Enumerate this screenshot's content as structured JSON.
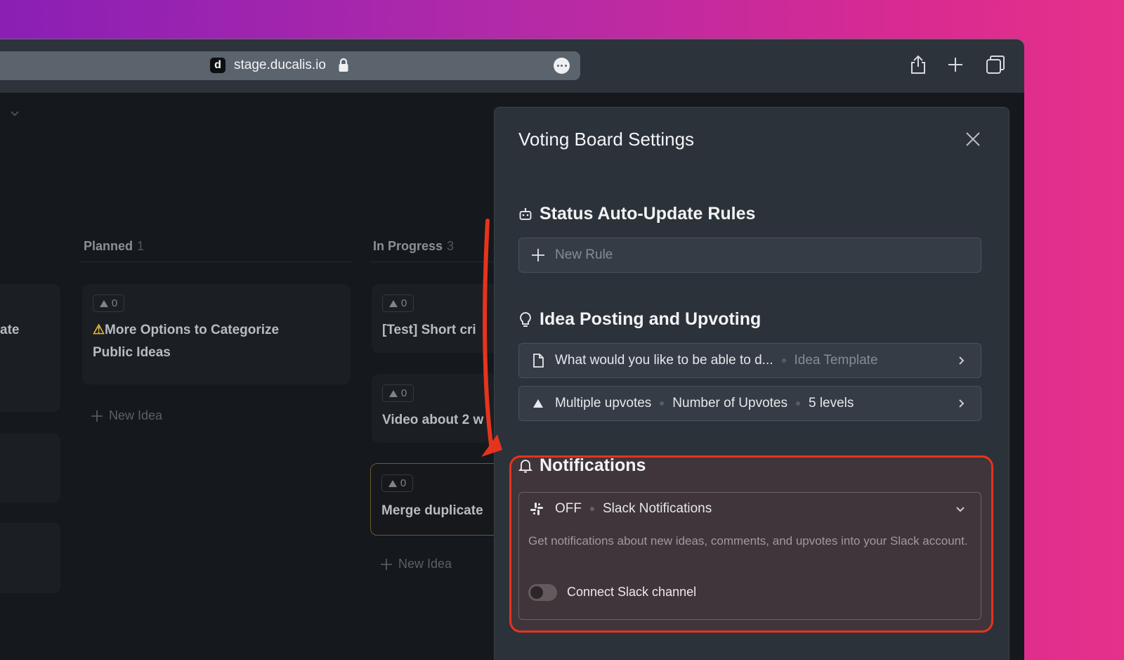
{
  "browser": {
    "favicon_letter": "d",
    "url": "stage.ducalis.io"
  },
  "board": {
    "columns": [
      {
        "title": "Planned",
        "count": "1"
      },
      {
        "title": "In Progress",
        "count": "3"
      }
    ],
    "left_fragment": "ate",
    "planned_cards": [
      {
        "votes": "0",
        "title_line1": "More Options to Categorize",
        "title_line2": "Public Ideas"
      }
    ],
    "in_progress_cards": [
      {
        "votes": "0",
        "title": "[Test] Short cri"
      },
      {
        "votes": "0",
        "title": "Video about 2 w"
      },
      {
        "votes": "0",
        "title": "Merge duplicate"
      }
    ],
    "new_idea_label": "New Idea"
  },
  "settings": {
    "title": "Voting Board Settings",
    "status_section": {
      "title": "Status Auto-Update Rules",
      "new_rule_placeholder": "New Rule"
    },
    "idea_section": {
      "title": "Idea Posting and Upvoting",
      "template_row": {
        "text": "What would you like to be able to d...",
        "tag": "Idea Template"
      },
      "upvote_row": {
        "mode": "Multiple upvotes",
        "label": "Number of Upvotes",
        "levels": "5 levels"
      }
    },
    "notifications": {
      "title": "Notifications",
      "status": "OFF",
      "name": "Slack Notifications",
      "description": "Get notifications about new ideas, comments, and upvotes into your Slack account.",
      "toggle_label": "Connect Slack channel",
      "toggle_on": false
    }
  },
  "colors": {
    "highlight": "#e5341e",
    "panel_bg": "#2c323a"
  }
}
